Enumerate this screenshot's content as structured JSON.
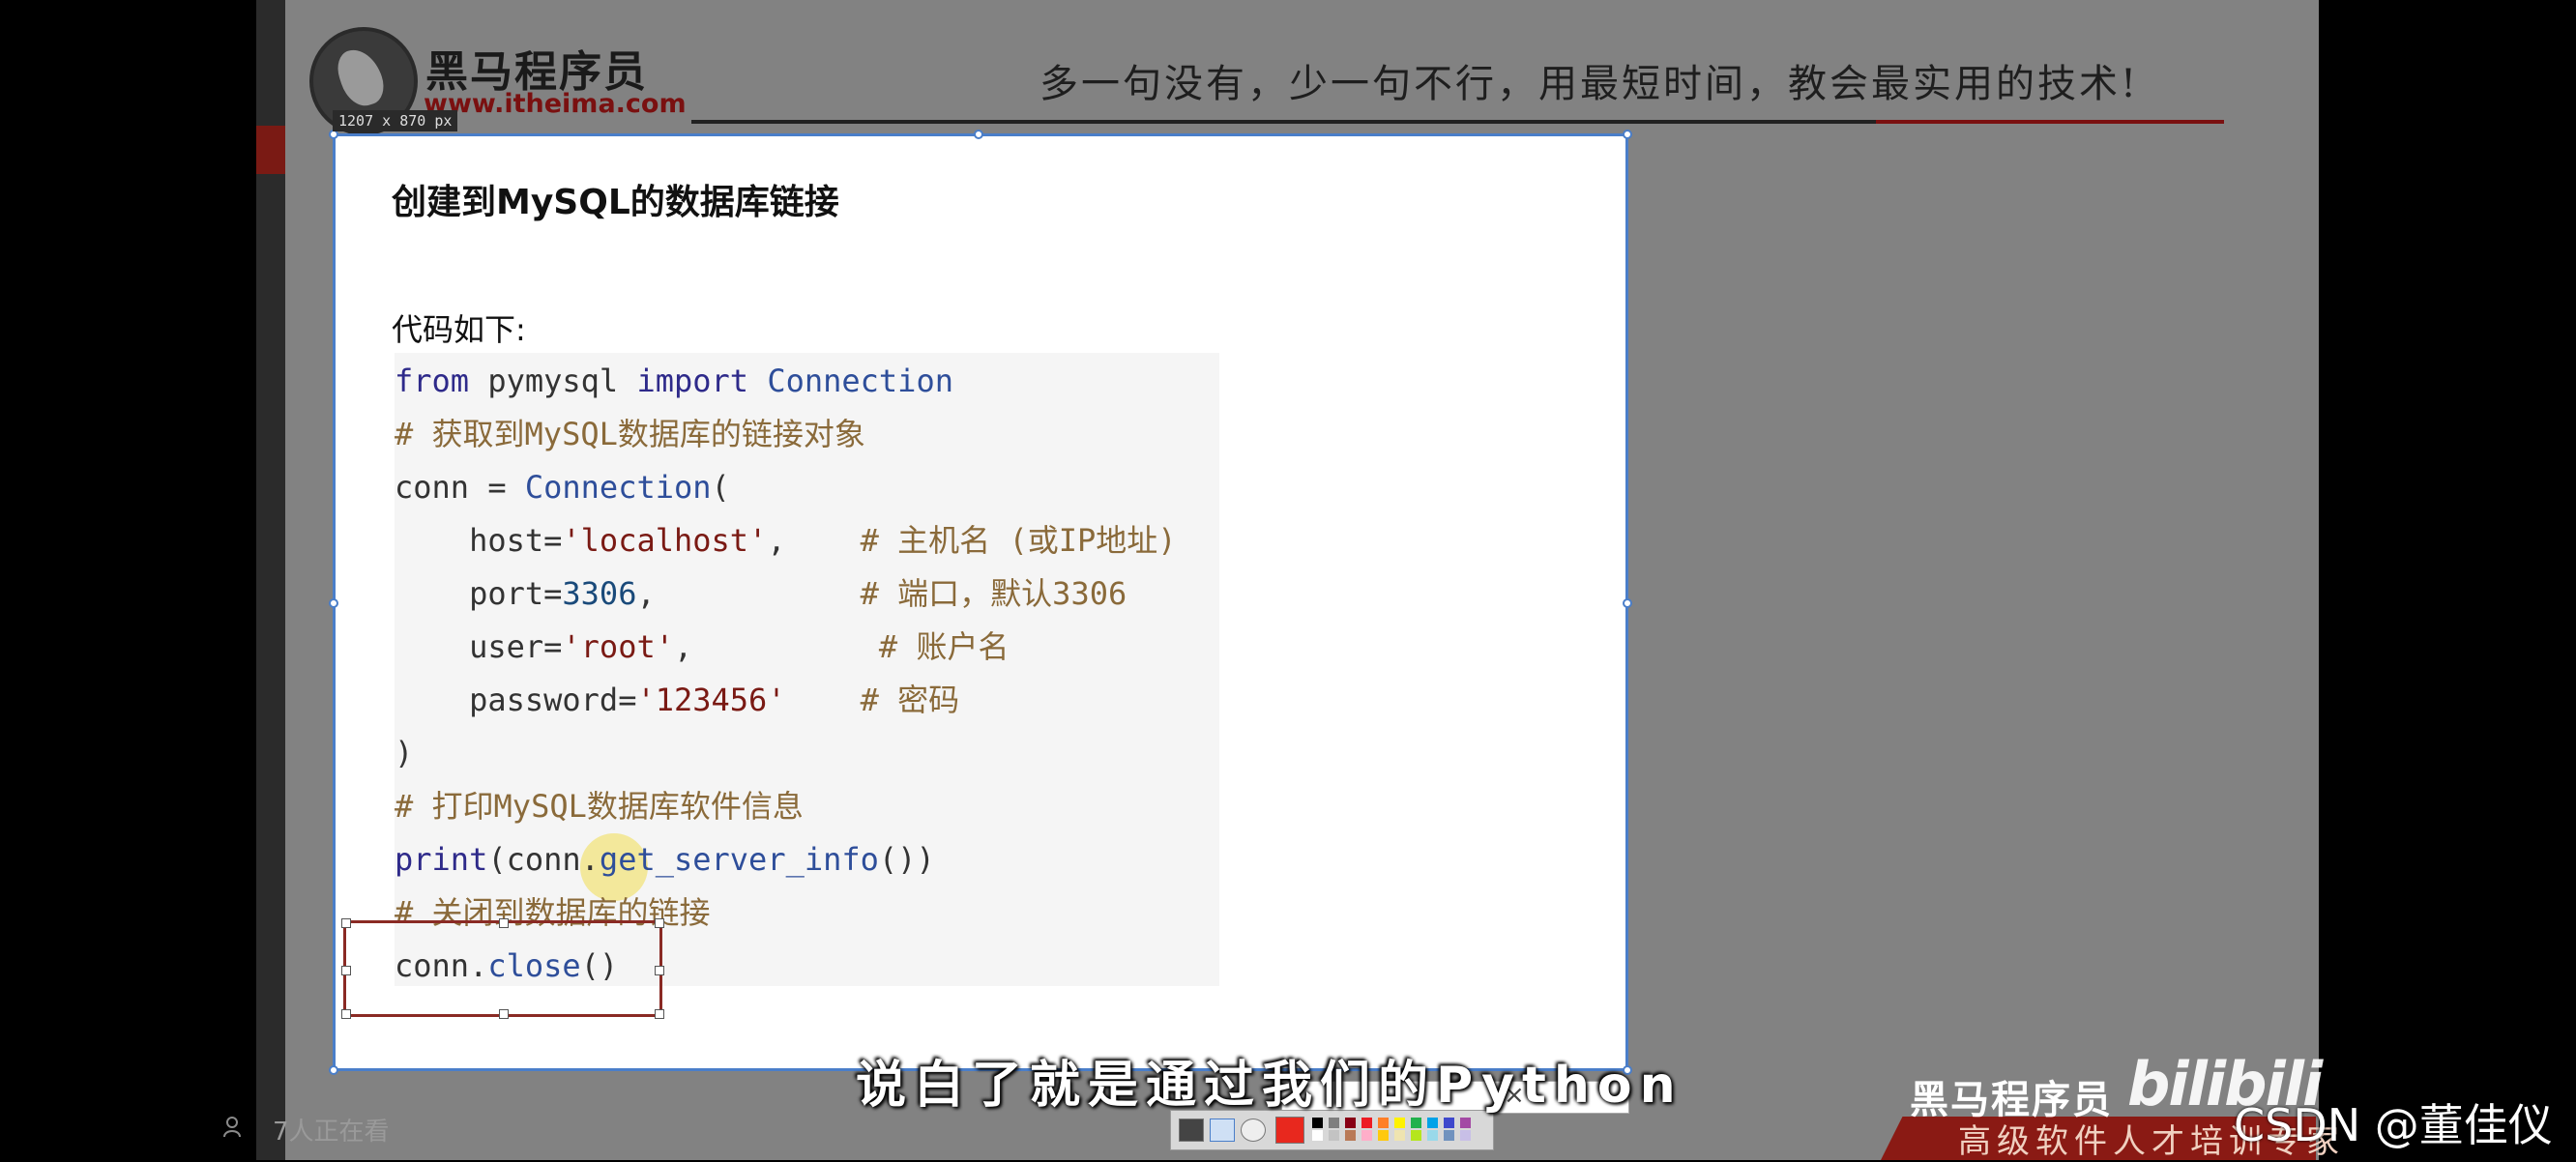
{
  "brand": {
    "name": "黑马程序员",
    "url": "www.itheima.com",
    "slogan": "多一句没有，少一句不行，用最短时间，教会最实用的技术!",
    "bottom_slogan": "高级软件人才培训专家"
  },
  "screenshot_tool": {
    "size_label": "1207 x 870  px"
  },
  "slide": {
    "title": "创建到MySQL的数据库链接",
    "intro": "代码如下:",
    "code": {
      "l1_kw_from": "from",
      "l1_mod": " pymysql ",
      "l1_kw_import": "import",
      "l1_cls": " Connection",
      "l2_comment": "# 获取到MySQL数据库的链接对象",
      "l3_var": "conn = ",
      "l3_cls": "Connection",
      "l3_paren": "(",
      "l4_key": "    host=",
      "l4_val": "'localhost'",
      "l4_pad": ",    ",
      "l4_comment": "# 主机名 (或IP地址)",
      "l5_key": "    port=",
      "l5_val": "3306",
      "l5_pad": ",           ",
      "l5_comment": "# 端口，默认3306",
      "l6_key": "    user=",
      "l6_val": "'root'",
      "l6_pad": ",          ",
      "l6_comment": "# 账户名",
      "l7_key": "    password=",
      "l7_val": "'123456'",
      "l7_pad": "    ",
      "l7_comment": "# 密码",
      "l8": ")",
      "l9_comment": "# 打印MySQL数据库软件信息",
      "l10_fn": "print",
      "l10_rest": "(conn.",
      "l10_method": "get_server_info",
      "l10_end": "())",
      "l11_comment": "# 关闭到数据库的链接",
      "l12_var": "conn.",
      "l12_method": "close",
      "l12_end": "()"
    }
  },
  "subtitle": "说白了就是通过我们的Python",
  "viewers": "7人正在看",
  "watermark": {
    "bilibili": "bilibili",
    "csdn": "CSDN @董佳仪"
  },
  "toolbar": {
    "swatch_colors": [
      "#000000",
      "#7f7f7f",
      "#880015",
      "#ed1c24",
      "#ff7f27",
      "#fff200",
      "#22b14c",
      "#00a2e8",
      "#3f48cc",
      "#a349a4",
      "#ffffff",
      "#c3c3c3",
      "#b97a57",
      "#ffaec9",
      "#ffc90e",
      "#efe4b0",
      "#b5e61d",
      "#99d9ea",
      "#7092be",
      "#c8bfe7"
    ],
    "active_color": "#e8281e"
  },
  "colors": {
    "selection_border": "#4a7ec9",
    "annotation_rect": "#8a2a24",
    "brand_red": "#7a1010"
  }
}
